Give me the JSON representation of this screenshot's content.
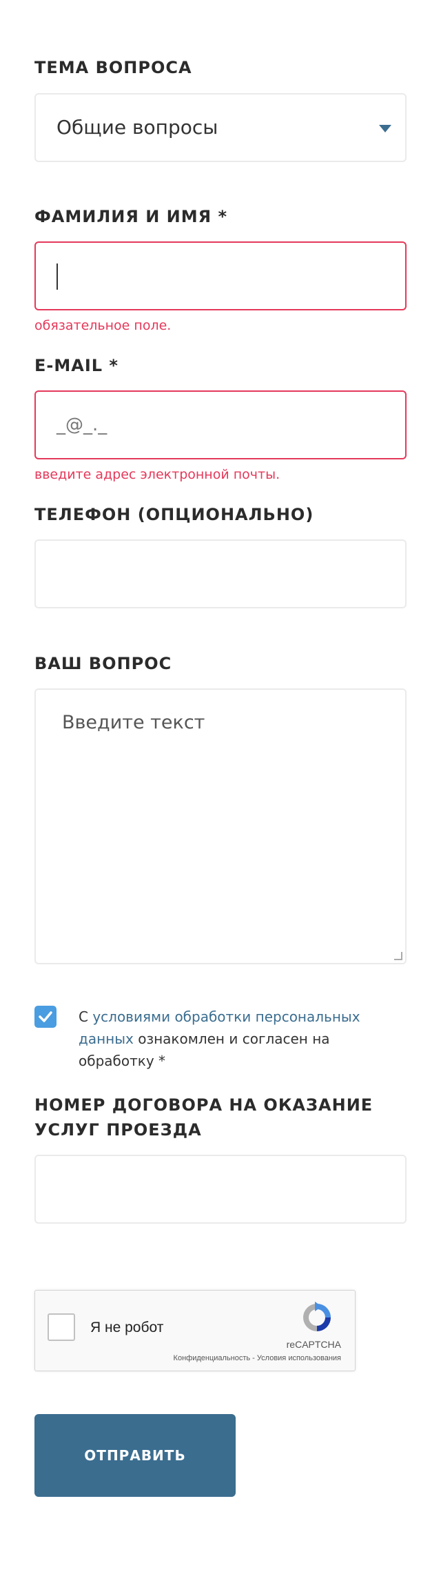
{
  "topic": {
    "label": "ТЕМА ВОПРОСА",
    "selected": "Общие вопросы"
  },
  "name": {
    "label": "ФАМИЛИЯ И ИМЯ *",
    "value": "",
    "error": "обязательное поле."
  },
  "email": {
    "label": "E-MAIL *",
    "mask": "_@_._",
    "error": "введите адрес электронной почты."
  },
  "phone": {
    "label": "ТЕЛЕФОН (ОПЦИОНАЛЬНО)",
    "value": ""
  },
  "question": {
    "label": "ВАШ ВОПРОС",
    "placeholder": "Введите текст"
  },
  "consent": {
    "checked": true,
    "prefix": "С ",
    "link": "условиями обработки персональных данных",
    "suffix": " ознакомлен и согласен на обработку *"
  },
  "contract": {
    "label": "НОМЕР ДОГОВОРА НА ОКАЗАНИЕ УСЛУГ ПРОЕЗДА",
    "value": ""
  },
  "recaptcha": {
    "label": "Я не робот",
    "brand": "reCAPTCHA",
    "links": "Конфиденциальность - Условия использования"
  },
  "submit": {
    "label": "ОТПРАВИТЬ"
  },
  "colors": {
    "accent": "#3b6d8f",
    "error": "#e5385a",
    "checkbox": "#4a9de0"
  }
}
